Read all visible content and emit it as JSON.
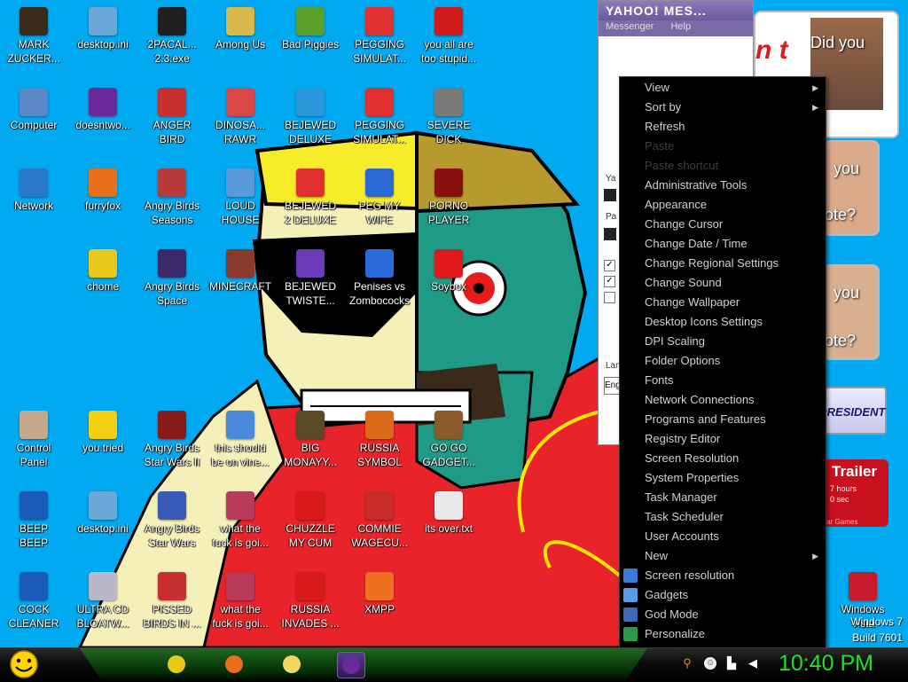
{
  "desktop_icons": [
    {
      "label": "MARK\nZUCKER...",
      "icon": "person-figure-icon",
      "color": "#3a2a1a"
    },
    {
      "label": "desktop.ini",
      "icon": "settings-file-icon",
      "color": "#6aa8d8"
    },
    {
      "label": "2PACAL...\n2.3.exe",
      "icon": "console-window-icon",
      "color": "#202020"
    },
    {
      "label": "Among Us",
      "icon": "folder-shortcut-icon",
      "color": "#d8b848"
    },
    {
      "label": "Bad Piggies",
      "icon": "green-pig-icon",
      "color": "#5aa02a"
    },
    {
      "label": "PEGGING\nSIMULAT...",
      "icon": "red-question-icon",
      "color": "#e03030"
    },
    {
      "label": "you all are\ntoo stupid...",
      "icon": "dev-cpp-icon",
      "color": "#d01a1a"
    },
    {
      "label": "Computer",
      "icon": "computer-icon",
      "color": "#5a88c8"
    },
    {
      "label": "doesntwo...",
      "icon": "yahoo-messenger-icon",
      "color": "#6a2a9a"
    },
    {
      "label": "ANGER\nBIRD",
      "icon": "angry-bird-icon",
      "color": "#c83030"
    },
    {
      "label": "DINOSA...\nRAWR",
      "icon": "paint-shortcut-icon",
      "color": "#d84848"
    },
    {
      "label": "BEJEWED\nDELUXE",
      "icon": "gem-icon",
      "color": "#2a98d8"
    },
    {
      "label": "PEGGING\nSIMULAT...",
      "icon": "red-question-icon",
      "color": "#e03030"
    },
    {
      "label": "SEVERE\nDICK",
      "icon": "gear-d-icon",
      "color": "#7a7a7a"
    },
    {
      "label": "Network",
      "icon": "globe-network-icon",
      "color": "#2a78c8"
    },
    {
      "label": "furryfox",
      "icon": "firefox-icon",
      "color": "#e8701a"
    },
    {
      "label": "Angry Birds\nSeasons",
      "icon": "angry-birds-seasons-icon",
      "color": "#b83a3a"
    },
    {
      "label": "LOUD\nHOUSE",
      "icon": "paint-shortcut-icon",
      "color": "#5a9ad8"
    },
    {
      "label": "BEJEWED\n2 DELUXE",
      "icon": "red-question-icon",
      "color": "#e03030"
    },
    {
      "label": "PEG MY\nWIFE",
      "icon": "peggle-icon",
      "color": "#2a6ad8"
    },
    {
      "label": "PORNO\nPLAYER",
      "icon": "flash-player-icon",
      "color": "#8a1010"
    },
    {
      "label": "chome",
      "icon": "chrome-icon",
      "color": "#e8c81a"
    },
    {
      "label": "Angry Birds\nSpace",
      "icon": "angry-birds-space-icon",
      "color": "#3a2a6a"
    },
    {
      "label": "MINECRAFT",
      "icon": "minecraft-block-icon",
      "color": "#8a3a2a"
    },
    {
      "label": "BEJEWED\nTWISTE...",
      "icon": "twist-gem-icon",
      "color": "#6a3ab8"
    },
    {
      "label": "Penises vs\nZombococks",
      "icon": "blue-bar-icon",
      "color": "#2a6ad8"
    },
    {
      "label": "Soybox",
      "icon": "soybox-icon",
      "color": "#e01a1a"
    },
    {
      "label": "Control\nPanel",
      "icon": "control-panel-icon",
      "color": "#c8a88a"
    },
    {
      "label": "you tried",
      "icon": "gold-star-icon",
      "color": "#f0d010"
    },
    {
      "label": "Angry Birds\nStar Wars II",
      "icon": "angry-birds-starwars2-icon",
      "color": "#8a1a1a"
    },
    {
      "label": "this should\nbe on vine...",
      "icon": "paint-shortcut-icon",
      "color": "#4a8ad8"
    },
    {
      "label": "BIG\nMONAYY...",
      "icon": "money-bag-icon",
      "color": "#5a4a2a"
    },
    {
      "label": "RUSSIA\nSYMBOL",
      "icon": "bricks-icon",
      "color": "#d86a1a"
    },
    {
      "label": "GO GO\nGADGET...",
      "icon": "briefcase-icon",
      "color": "#8a5a2a"
    },
    {
      "label": "BEEP\nBEEP",
      "icon": "blue-bar-icon",
      "color": "#1a5ab8"
    },
    {
      "label": "desktop.ini",
      "icon": "settings-file-icon",
      "color": "#6aa8d8"
    },
    {
      "label": "Angry Birds\nStar Wars",
      "icon": "angry-birds-starwars-icon",
      "color": "#3a5ab8"
    },
    {
      "label": "what the\nfuck is goi...",
      "icon": "paint-shortcut-icon",
      "color": "#b83a5a"
    },
    {
      "label": "CHUZZLE\nMY CUM",
      "icon": "chuzzle-icon",
      "color": "#d81a1a"
    },
    {
      "label": "COMMIE\nWAGECU...",
      "icon": "eagle-flag-icon",
      "color": "#c82a2a"
    },
    {
      "label": "its over.txt",
      "icon": "text-file-icon",
      "color": "#e8e8e8"
    },
    {
      "label": "COCK\nCLEANER",
      "icon": "blue-bar-icon",
      "color": "#1a5ab8"
    },
    {
      "label": "ULTRA CD\nBLOATW...",
      "icon": "cd-disc-icon",
      "color": "#b8b8c8"
    },
    {
      "label": "PISSED\nBIRDS IN ...",
      "icon": "angry-bird-icon",
      "color": "#c83030"
    },
    {
      "label": "what the\nfuck is goi...",
      "icon": "paint-shortcut-icon",
      "color": "#b83a5a"
    },
    {
      "label": "RUSSIA\nINVADES ...",
      "icon": "hazard-icon",
      "color": "#d81a1a"
    },
    {
      "label": "XMPP",
      "icon": "xampp-icon",
      "color": "#f07020"
    },
    {
      "label": "Windows\nVista",
      "icon": "recycle-bin-icon",
      "color": "#c81a2a"
    }
  ],
  "yahoo_window": {
    "title": "YAHOO! MES...",
    "menu": [
      "Messenger",
      "Help"
    ],
    "fragments": [
      "Ya",
      "Pa",
      "Lan",
      "Eng"
    ]
  },
  "ads": {
    "text_did_you": "Did you",
    "text_n_t": "n t",
    "text_you": "you",
    "text_ote": "ote?",
    "text_you2": "you",
    "text_ote2": "ote?",
    "president": "PRESIDENT",
    "trailer_title": "Trailer",
    "trailer_line1": "7 hours",
    "trailer_line2": "0 sec",
    "trailer_line3": "tar Games"
  },
  "context_menu": {
    "items": [
      {
        "label": "View",
        "submenu": true,
        "disabled": false,
        "icon": ""
      },
      {
        "label": "Sort by",
        "submenu": true,
        "disabled": false,
        "icon": ""
      },
      {
        "label": "Refresh",
        "submenu": false,
        "disabled": false,
        "icon": ""
      },
      {
        "label": "Paste",
        "submenu": false,
        "disabled": true,
        "icon": ""
      },
      {
        "label": "Paste shortcut",
        "submenu": false,
        "disabled": true,
        "icon": ""
      },
      {
        "label": "Administrative Tools",
        "submenu": false,
        "disabled": false,
        "icon": ""
      },
      {
        "label": "Appearance",
        "submenu": false,
        "disabled": false,
        "icon": ""
      },
      {
        "label": "Change Cursor",
        "submenu": false,
        "disabled": false,
        "icon": ""
      },
      {
        "label": "Change Date / Time",
        "submenu": false,
        "disabled": false,
        "icon": ""
      },
      {
        "label": "Change Regional Settings",
        "submenu": false,
        "disabled": false,
        "icon": ""
      },
      {
        "label": "Change Sound",
        "submenu": false,
        "disabled": false,
        "icon": ""
      },
      {
        "label": "Change Wallpaper",
        "submenu": false,
        "disabled": false,
        "icon": ""
      },
      {
        "label": "Desktop Icons Settings",
        "submenu": false,
        "disabled": false,
        "icon": ""
      },
      {
        "label": "DPI Scaling",
        "submenu": false,
        "disabled": false,
        "icon": ""
      },
      {
        "label": "Folder Options",
        "submenu": false,
        "disabled": false,
        "icon": ""
      },
      {
        "label": "Fonts",
        "submenu": false,
        "disabled": false,
        "icon": ""
      },
      {
        "label": "Network Connections",
        "submenu": false,
        "disabled": false,
        "icon": ""
      },
      {
        "label": "Programs and Features",
        "submenu": false,
        "disabled": false,
        "icon": ""
      },
      {
        "label": "Registry Editor",
        "submenu": false,
        "disabled": false,
        "icon": ""
      },
      {
        "label": "Screen Resolution",
        "submenu": false,
        "disabled": false,
        "icon": ""
      },
      {
        "label": "System Properties",
        "submenu": false,
        "disabled": false,
        "icon": ""
      },
      {
        "label": "Task Manager",
        "submenu": false,
        "disabled": false,
        "icon": ""
      },
      {
        "label": "Task Scheduler",
        "submenu": false,
        "disabled": false,
        "icon": ""
      },
      {
        "label": "User Accounts",
        "submenu": false,
        "disabled": false,
        "icon": ""
      },
      {
        "label": "New",
        "submenu": true,
        "disabled": false,
        "icon": ""
      },
      {
        "label": "Screen resolution",
        "submenu": false,
        "disabled": false,
        "icon": "monitor-icon"
      },
      {
        "label": "Gadgets",
        "submenu": false,
        "disabled": false,
        "icon": "gadgets-icon"
      },
      {
        "label": "God Mode",
        "submenu": false,
        "disabled": false,
        "icon": "god-mode-icon"
      },
      {
        "label": "Personalize",
        "submenu": false,
        "disabled": false,
        "icon": "personalize-icon"
      }
    ]
  },
  "watermark": {
    "line1": "Windows 7",
    "line2": "Build 7601"
  },
  "taskbar": {
    "start_icon": "smiley-start-icon",
    "pinned": [
      {
        "name": "chrome-icon",
        "color": "#e8c81a",
        "active": false
      },
      {
        "name": "firefox-icon",
        "color": "#e8701a",
        "active": false
      },
      {
        "name": "folder-explorer-icon",
        "color": "#f0d860",
        "active": false
      },
      {
        "name": "yahoo-messenger-icon",
        "color": "#6a2a9a",
        "active": true
      }
    ],
    "tray": [
      "search-icon",
      "smiley-tray-icon",
      "network-icon",
      "speaker-icon"
    ],
    "clock": "10:40 PM"
  },
  "colors": {
    "desktop_bg": "#00a9f0",
    "menu_bg": "#000000",
    "menu_text": "#d0d0d0",
    "clock_green": "#22e022"
  }
}
